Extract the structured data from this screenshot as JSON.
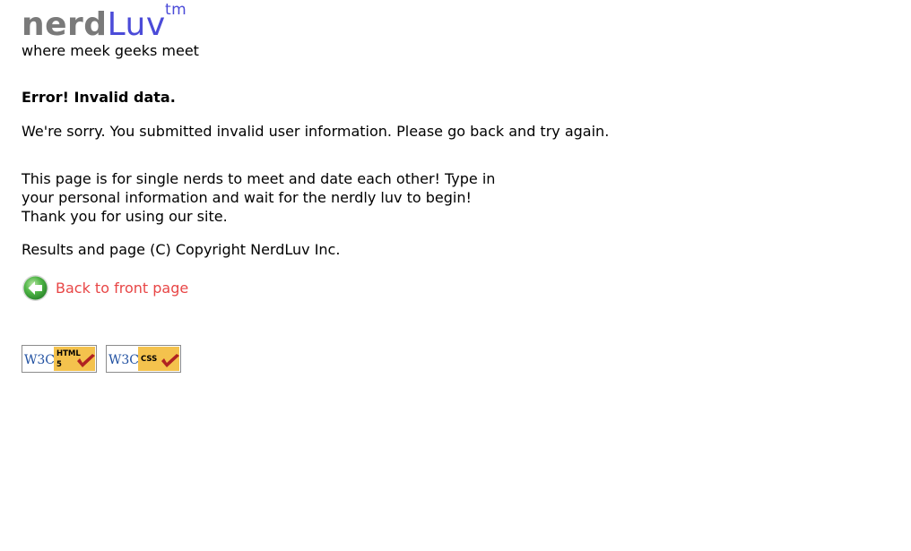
{
  "header": {
    "logo_part_1": "nerd",
    "logo_part_2": "Luv",
    "trademark": "tm",
    "tagline": "where meek geeks meet"
  },
  "error": {
    "heading": "Error! Invalid data.",
    "message": "We're sorry. You submitted invalid user information. Please go back and try again."
  },
  "footer": {
    "about_lines": [
      "This page is for single nerds to meet and date each other! Type in",
      "your personal information and wait for the nerdly luv to begin!",
      "Thank you for using our site."
    ],
    "copyright": "Results and page (C) Copyright NerdLuv Inc.",
    "back_link_label": "Back to front page",
    "badges": {
      "html_w3c": "W3C",
      "html_label_1": "HTML",
      "html_label_2": "5",
      "css_w3c": "W3C",
      "css_label": "CSS"
    }
  },
  "colors": {
    "logo_grey": "#7a7a7a",
    "logo_blue": "#4b4bd8",
    "link_red": "#e84646",
    "badge_yellow": "#f4c24d",
    "checkmark_red": "#b02222",
    "icon_green": "#3aa53a"
  },
  "icons": {
    "back_icon": "back-arrow-icon",
    "checkmark_icon": "checkmark-icon"
  }
}
